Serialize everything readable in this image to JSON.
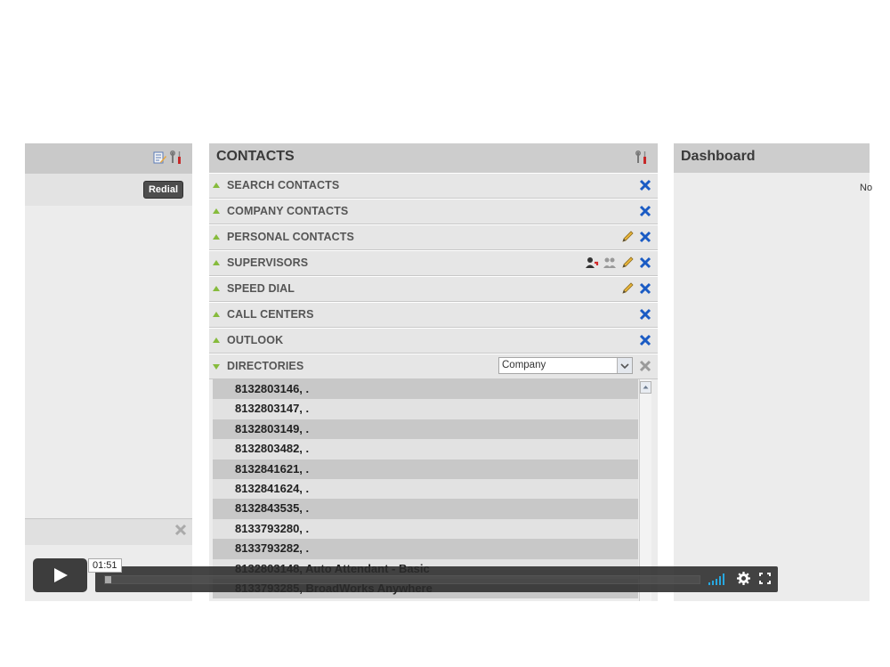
{
  "left_panel": {
    "redial_label": "Redial"
  },
  "contacts": {
    "title": "CONTACTS",
    "sections": [
      {
        "label": "SEARCH CONTACTS"
      },
      {
        "label": "COMPANY CONTACTS"
      },
      {
        "label": "PERSONAL CONTACTS"
      },
      {
        "label": "SUPERVISORS"
      },
      {
        "label": "SPEED DIAL"
      },
      {
        "label": "CALL CENTERS"
      },
      {
        "label": "OUTLOOK"
      },
      {
        "label": "DIRECTORIES"
      }
    ],
    "directory_select": "Company",
    "directory_entries": [
      "8132803146, .",
      "8132803147, .",
      "8132803149, .",
      "8132803482, .",
      "8132841621, .",
      "8132841624, .",
      "8132843535, .",
      "8133793280, .",
      "8133793282, .",
      "8132803148, Auto Attendant - Basic",
      "8133793285, BroadWorks Anywhere"
    ]
  },
  "dashboard": {
    "title": "Dashboard",
    "text": "No"
  },
  "player": {
    "time": "01:51",
    "progress": 0.01
  },
  "colors": {
    "accent_green": "#86bb3c",
    "close_blue": "#1a5bc4",
    "volume_blue": "#27a8e0"
  }
}
